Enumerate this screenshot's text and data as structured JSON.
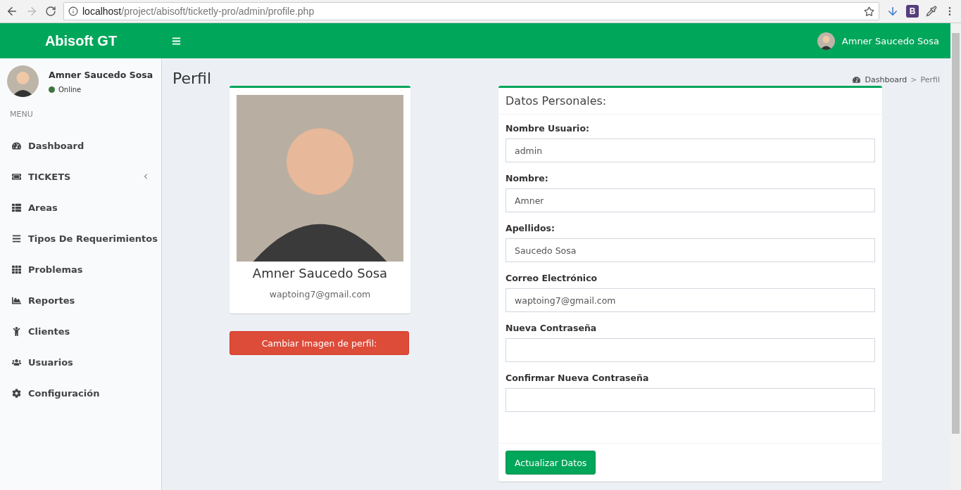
{
  "browser": {
    "url_host": "localhost",
    "url_path": "/project/abisoft/ticketly-pro/admin/profile.php",
    "extension_letter": "B"
  },
  "header": {
    "logo": "Abisoft GT",
    "user_name": "Amner Saucedo Sosa"
  },
  "sidebar": {
    "user_name": "Amner Saucedo Sosa",
    "status": "Online",
    "menu_label": "MENU",
    "items": [
      {
        "label": "Dashboard",
        "has_submenu": false
      },
      {
        "label": "TICKETS",
        "has_submenu": true
      },
      {
        "label": "Areas",
        "has_submenu": false
      },
      {
        "label": "Tipos De Requerimientos",
        "has_submenu": false
      },
      {
        "label": "Problemas",
        "has_submenu": false
      },
      {
        "label": "Reportes",
        "has_submenu": false
      },
      {
        "label": "Clientes",
        "has_submenu": false
      },
      {
        "label": "Usuarios",
        "has_submenu": false
      },
      {
        "label": "Configuración",
        "has_submenu": false
      }
    ]
  },
  "page": {
    "title": "Perfil",
    "breadcrumb_separator": ">",
    "breadcrumb": [
      {
        "label": "Dashboard"
      },
      {
        "label": "Perfil"
      }
    ]
  },
  "profile_card": {
    "name": "Amner Saucedo Sosa",
    "email": "waptoing7@gmail.com",
    "change_image_button": "Cambiar Imagen de perfil:"
  },
  "form": {
    "title": "Datos Personales:",
    "fields": [
      {
        "label": "Nombre Usuario:",
        "value": "admin"
      },
      {
        "label": "Nombre:",
        "value": "Amner"
      },
      {
        "label": "Apellidos:",
        "value": "Saucedo Sosa"
      },
      {
        "label": "Correo Electrónico",
        "value": "waptoing7@gmail.com"
      },
      {
        "label": "Nueva Contraseña"
      },
      {
        "label": "Confirmar Nueva Contraseña"
      }
    ],
    "submit": "Actualizar Datos"
  }
}
